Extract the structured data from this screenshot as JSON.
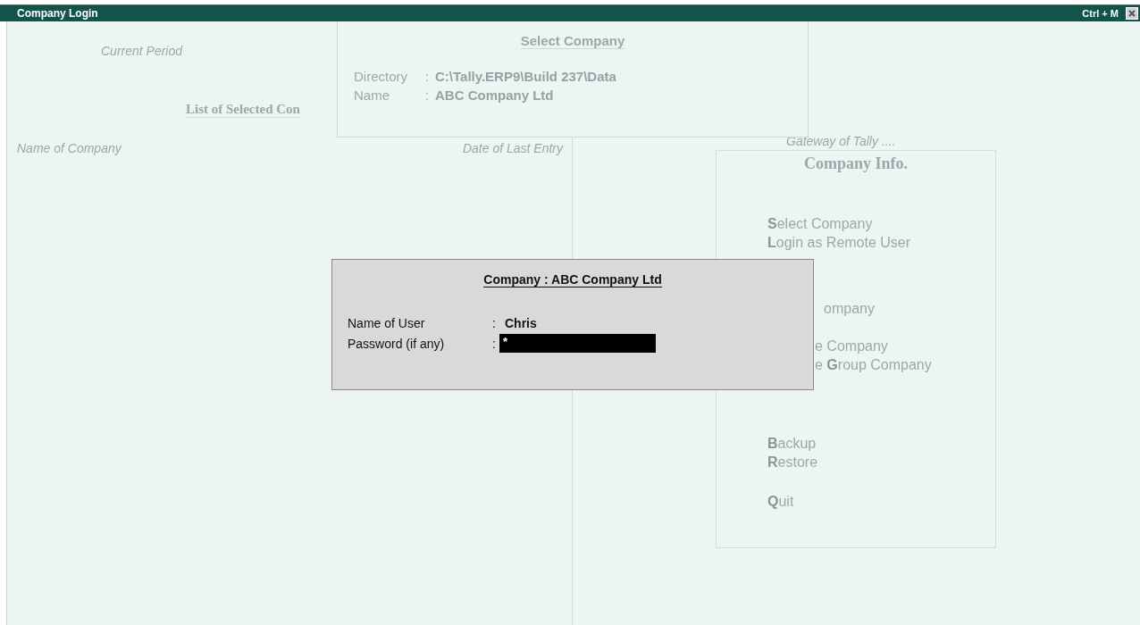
{
  "window": {
    "title": "Company Login",
    "shortcut": "Ctrl + M"
  },
  "left_pane": {
    "current_period_label": "Current Period",
    "list_heading": "List of Selected Con",
    "columns": [
      "Name of Company",
      "Date of Last Entry"
    ]
  },
  "right_pane": {
    "gateway_title": "Gateway of Tally ....",
    "menu_title": "Company Info.",
    "menu_groups": [
      {
        "items": [
          "**S**elect Company",
          "**L**ogin as Remote User"
        ]
      },
      {
        "items": [
          "ompany"
        ]
      },
      {
        "items": [
          "e Company",
          "e **G**roup Company"
        ]
      },
      {
        "items": [
          "**B**ackup",
          "**R**estore"
        ]
      },
      {
        "items": [
          "**Q**uit"
        ]
      }
    ]
  },
  "select_company": {
    "title": "Select Company",
    "fields": [
      {
        "label": "Directory",
        "separator": ":",
        "value": "C:\\Tally.ERP9\\Build 237\\Data"
      },
      {
        "label": "Name",
        "separator": ":",
        "value": "ABC Company Ltd"
      }
    ]
  },
  "login": {
    "title": "Company : ABC Company Ltd",
    "fields": [
      {
        "kind": "text",
        "label": "Name of User",
        "separator": ":",
        "value": "Chris"
      },
      {
        "kind": "password",
        "label": "Password (if any)",
        "separator": ":",
        "value": "*"
      }
    ]
  }
}
